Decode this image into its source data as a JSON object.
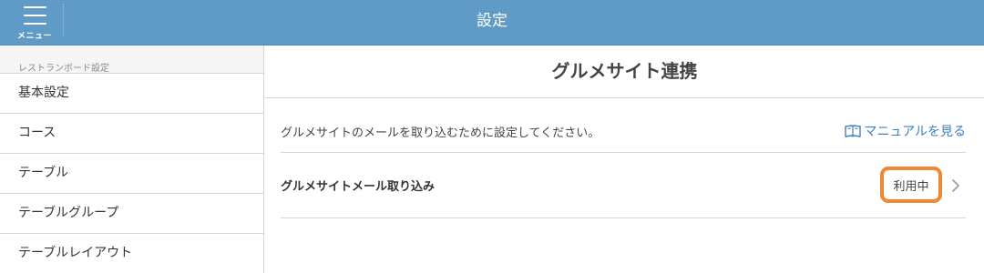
{
  "header": {
    "title": "設定",
    "menu_label": "メニュー"
  },
  "sidebar": {
    "section_label": "レストランボード設定",
    "items": [
      {
        "label": "基本設定"
      },
      {
        "label": "コース"
      },
      {
        "label": "テーブル"
      },
      {
        "label": "テーブルグループ"
      },
      {
        "label": "テーブルレイアウト"
      }
    ]
  },
  "main": {
    "title": "グルメサイト連携",
    "description": "グルメサイトのメールを取り込むために設定してください。",
    "manual_link": "マニュアルを見る",
    "setting": {
      "label": "グルメサイトメール取り込み",
      "status": "利用中"
    }
  },
  "colors": {
    "header_bg": "#5f9bc6",
    "link": "#3d7fc0",
    "highlight": "#ed8833"
  },
  "icons": {
    "menu": "hamburger-icon",
    "manual": "book-icon",
    "row": "chevron-right-icon"
  }
}
